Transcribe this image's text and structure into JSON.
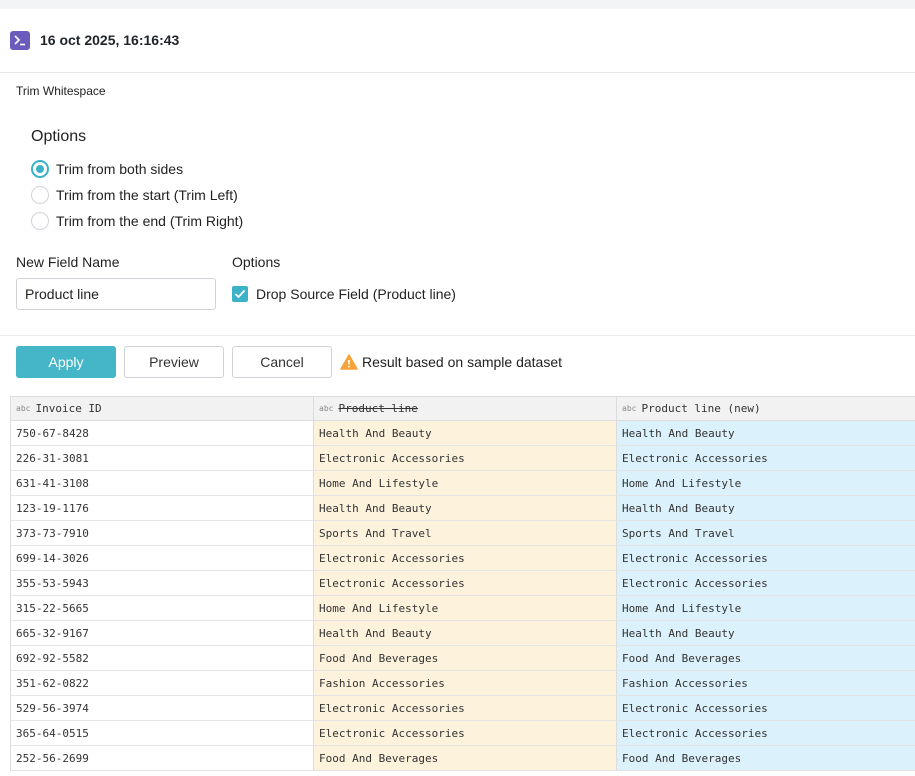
{
  "header": {
    "timestamp": "16 oct 2025, 16:16:43",
    "icon": "terminal-icon",
    "icon_color": "#6b5bbd"
  },
  "step_title": "Trim Whitespace",
  "options": {
    "heading": "Options",
    "radios": [
      {
        "label": "Trim from both sides",
        "checked": true
      },
      {
        "label": "Trim from the start (Trim Left)",
        "checked": false
      },
      {
        "label": "Trim from the end (Trim Right)",
        "checked": false
      }
    ]
  },
  "new_field": {
    "label": "New Field Name",
    "value": "Product line"
  },
  "drop_options": {
    "label": "Options",
    "checkbox_label": "Drop Source Field (Product line)",
    "checked": true
  },
  "actions": {
    "apply": "Apply",
    "preview": "Preview",
    "cancel": "Cancel",
    "warning": "Result based on sample dataset"
  },
  "colors": {
    "accent": "#45b5c8",
    "source_column_bg": "#fdf3dd",
    "new_column_bg": "#dbf1fb",
    "warning": "#f5a33b"
  },
  "table": {
    "type_tag": "abc",
    "columns": [
      "Invoice ID",
      "Product line",
      "Product line (new)"
    ],
    "rows": [
      [
        "750-67-8428",
        "Health And Beauty",
        "Health And Beauty"
      ],
      [
        "226-31-3081",
        "Electronic Accessories",
        "Electronic Accessories"
      ],
      [
        "631-41-3108",
        "Home And Lifestyle",
        "Home And Lifestyle"
      ],
      [
        "123-19-1176",
        "Health And Beauty",
        "Health And Beauty"
      ],
      [
        "373-73-7910",
        "Sports And Travel",
        "Sports And Travel"
      ],
      [
        "699-14-3026",
        "Electronic Accessories",
        "Electronic Accessories"
      ],
      [
        "355-53-5943",
        "Electronic Accessories",
        "Electronic Accessories"
      ],
      [
        "315-22-5665",
        "Home And Lifestyle",
        "Home And Lifestyle"
      ],
      [
        "665-32-9167",
        "Health And Beauty",
        "Health And Beauty"
      ],
      [
        "692-92-5582",
        "Food And Beverages",
        "Food And Beverages"
      ],
      [
        "351-62-0822",
        "Fashion Accessories",
        "Fashion Accessories"
      ],
      [
        "529-56-3974",
        "Electronic Accessories",
        "Electronic Accessories"
      ],
      [
        "365-64-0515",
        "Electronic Accessories",
        "Electronic Accessories"
      ],
      [
        "252-56-2699",
        "Food And Beverages",
        "Food And Beverages"
      ]
    ]
  }
}
